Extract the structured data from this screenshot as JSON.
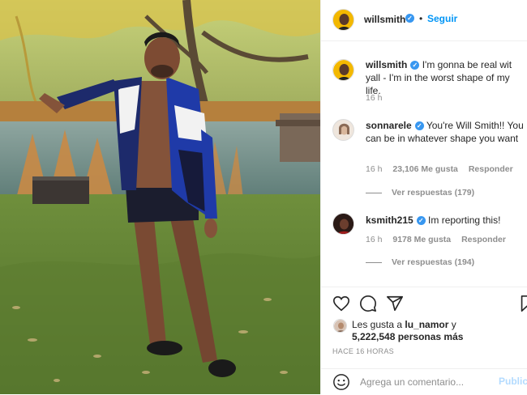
{
  "post": {
    "username": "willsmith",
    "follow_label": "Seguir",
    "separator": "•"
  },
  "caption": {
    "username": "willsmith",
    "text": "I'm gonna be real wit yall - I'm in the worst shape of my life.",
    "time": "16 h"
  },
  "comments": [
    {
      "username": "sonnarele",
      "text": "You're Will Smith!! You can be in whatever shape you want",
      "time": "16 h",
      "likes": "23,106 Me gusta",
      "reply_label": "Responder",
      "view_replies": "Ver respuestas (179)"
    },
    {
      "username": "ksmith215",
      "text": "Im reporting this!",
      "time": "16 h",
      "likes": "9178 Me gusta",
      "reply_label": "Responder",
      "view_replies": "Ver respuestas (194)"
    }
  ],
  "likes": {
    "prefix": "Les gusta a",
    "user": "lu_namor",
    "connector": "y",
    "count": "5,222,548 personas más"
  },
  "posted_ago": "HACE 16 HORAS",
  "add_comment": {
    "placeholder": "Agrega un comentario...",
    "publish_label": "Publicar"
  },
  "colors": {
    "accent": "#0095f6",
    "verified": "#3897f0",
    "muted": "#8e8e8e",
    "text": "#262626"
  },
  "icons": [
    "heart-icon",
    "comment-icon",
    "share-icon",
    "bookmark-icon",
    "emoji-icon",
    "verified-badge-icon"
  ]
}
